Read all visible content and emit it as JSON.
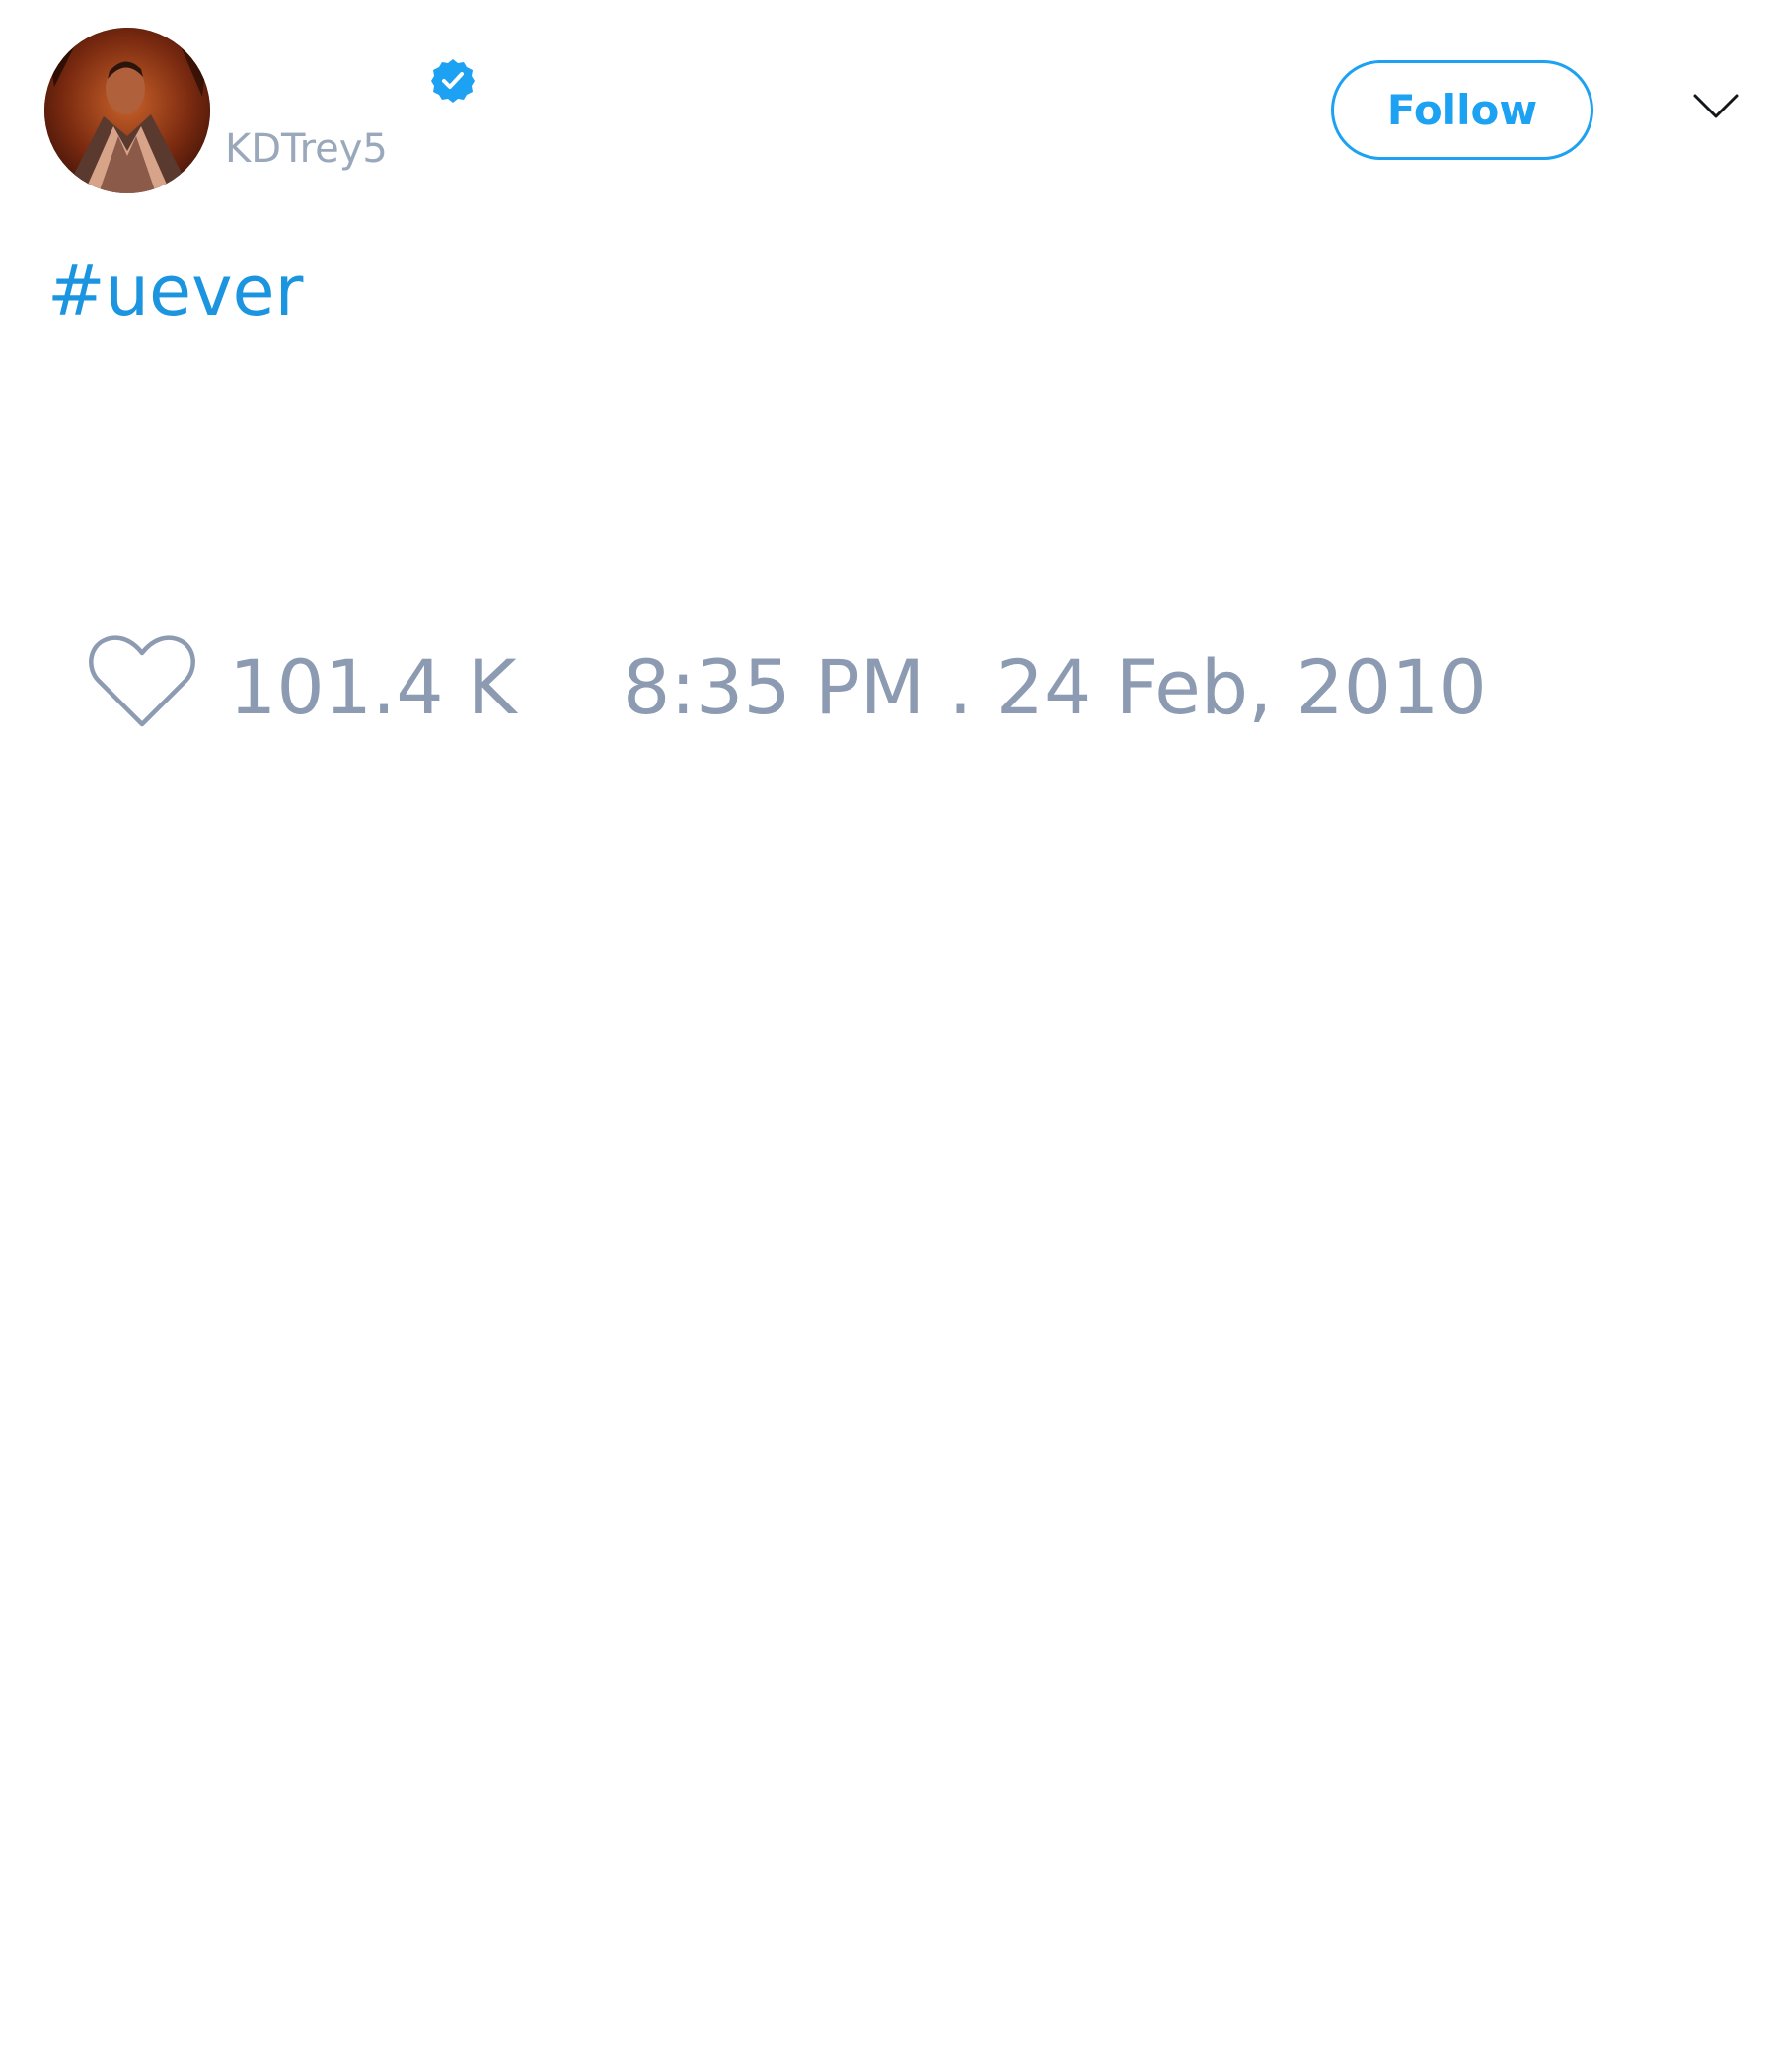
{
  "tweet": {
    "author": {
      "display_name": "",
      "handle": "KDTrey5",
      "verified": true
    },
    "follow_label": "Follow",
    "text": {
      "hashtag": "#uever"
    },
    "likes": "101.4 K",
    "timestamp": "8:35 PM . 24 Feb, 2010"
  },
  "icons": {
    "verified": "verified-badge-icon",
    "more": "chevron-down-icon",
    "like": "heart-icon"
  },
  "colors": {
    "accent": "#1da1f2",
    "hashtag": "#1b95e0",
    "muted": "#8c9bb2",
    "background": "#ffffff"
  }
}
